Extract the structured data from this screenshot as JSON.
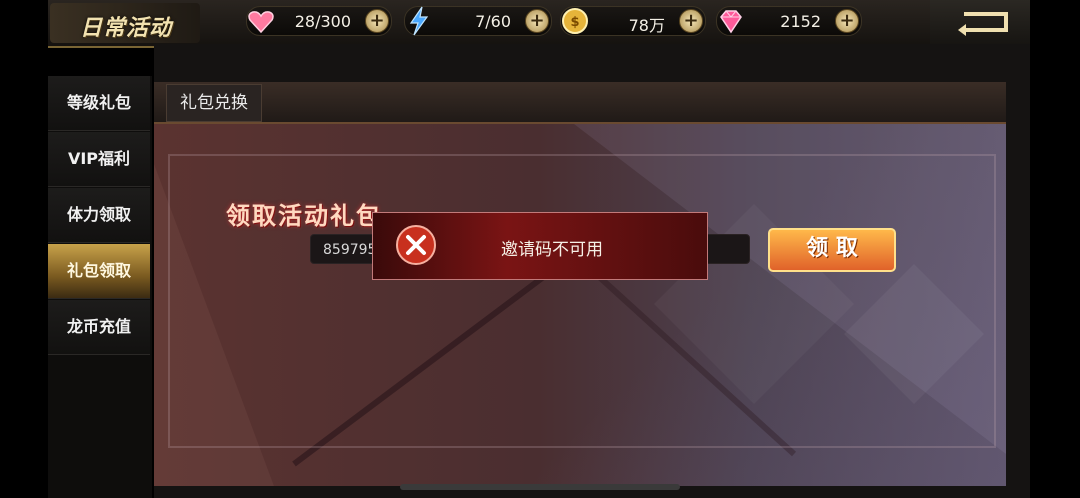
{
  "header": {
    "title": "日常活动",
    "resources": [
      {
        "icon": "heart-gem-icon",
        "value": "28/300"
      },
      {
        "icon": "lightning-icon",
        "value": "7/60"
      },
      {
        "icon": "gold-coin-icon",
        "value": "78万"
      },
      {
        "icon": "diamond-icon",
        "value": "2152"
      }
    ]
  },
  "sidebar": {
    "items": [
      {
        "label": "等级礼包",
        "active": false
      },
      {
        "label": "VIP福利",
        "active": false
      },
      {
        "label": "体力领取",
        "active": false
      },
      {
        "label": "礼包领取",
        "active": true
      },
      {
        "label": "龙币充值",
        "active": false
      }
    ]
  },
  "tabs": [
    {
      "label": "礼包兑换"
    }
  ],
  "panel": {
    "heading": "领取活动礼包",
    "code_value": "859795",
    "claim_label": "领 取"
  },
  "toast": {
    "message": "邀请码不可用"
  },
  "colors": {
    "accent_gold": "#c8a24a",
    "toast_red": "#7a1414",
    "claim_orange": "#e0622a"
  }
}
